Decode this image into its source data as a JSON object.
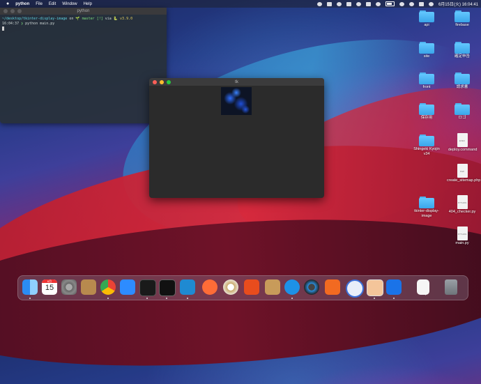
{
  "menubar": {
    "apple": "",
    "items": [
      "python",
      "File",
      "Edit",
      "Window",
      "Help"
    ],
    "datetime": "6月15日(火) 16:04:41"
  },
  "terminal": {
    "title": "python",
    "line1": {
      "path": "~/desktop/tkinter-display-image",
      "on": "on",
      "branch": "🌱 master [!]",
      "via": "via",
      "version": "🐍 v3.9.0"
    },
    "line2": {
      "time": "16:04:37",
      "prompt": "❯",
      "command": "python main.py"
    }
  },
  "tk_window": {
    "title": "tk"
  },
  "desktop_icons": [
    {
      "label": "api",
      "kind": "folder"
    },
    {
      "label": "firebase",
      "kind": "folder"
    },
    {
      "label": "site",
      "kind": "folder"
    },
    {
      "label": "確定申告",
      "kind": "folder"
    },
    {
      "label": "front",
      "kind": "folder"
    },
    {
      "label": "請求書",
      "kind": "folder"
    },
    {
      "label": "保存用",
      "kind": "folder"
    },
    {
      "label": "ロゴ",
      "kind": "folder"
    },
    {
      "label": "Shingeki Kyojin v34",
      "kind": "folder"
    },
    {
      "label": "deploy.command",
      "kind": "doc",
      "badge": "EXEC"
    },
    {
      "label": "create_sitemap.php",
      "kind": "doc",
      "badge": "PHP"
    },
    {
      "label": "tkinter-display-image",
      "kind": "folder"
    },
    {
      "label": "404_checker.py",
      "kind": "doc",
      "badge": "PYTHON"
    },
    {
      "label": "main.py",
      "kind": "doc",
      "badge": "PYTHON"
    }
  ],
  "dock": {
    "calendar_month": "6月",
    "calendar_day": "15",
    "apps": [
      "finder-icon",
      "calendar-icon",
      "system-preferences-icon",
      "contacts-icon",
      "chrome-icon",
      "zoom-icon",
      "activity-monitor-icon",
      "terminal-icon",
      "vscode-icon",
      "postman-icon",
      "sequel-icon",
      "chart-app-icon",
      "archive-icon",
      "docker-icon",
      "quicktime-icon",
      "sourcetree-icon",
      "app-icon",
      "preview-icon",
      "infinity-icon",
      "document-icon",
      "trash-icon"
    ]
  }
}
